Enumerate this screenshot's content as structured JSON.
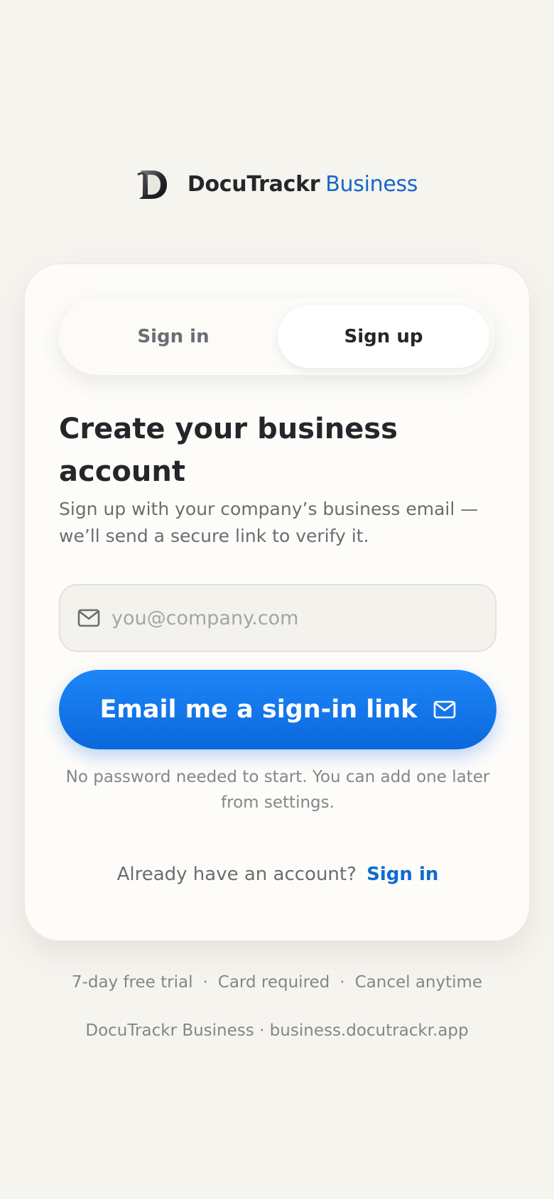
{
  "brand": {
    "name": "DocuTrackr",
    "suffix": "Business",
    "logo_icon": "d-monogram-logo",
    "accent_color": "#1468c8"
  },
  "tabs": [
    {
      "label": "Sign in",
      "active": false
    },
    {
      "label": "Sign up",
      "active": true
    }
  ],
  "form": {
    "heading": "Create your business account",
    "subtext": "Sign up with your company’s business email — we’ll send a secure link to verify it.",
    "email_icon": "mail-icon",
    "email_placeholder": "you@company.com",
    "email_value": "",
    "submit_label": "Email me a sign-in link",
    "submit_icon": "mail-icon",
    "submit_color": "#0f72e8",
    "note": "No password needed to start. You can add one later from settings."
  },
  "signin_prompt": {
    "text": "Already have an account?",
    "link_label": "Sign in"
  },
  "footer": {
    "features": [
      "7-day free trial",
      "Card required",
      "Cancel anytime"
    ],
    "separator": "·",
    "domain_line": "DocuTrackr Business · business.docutrackr.app"
  }
}
